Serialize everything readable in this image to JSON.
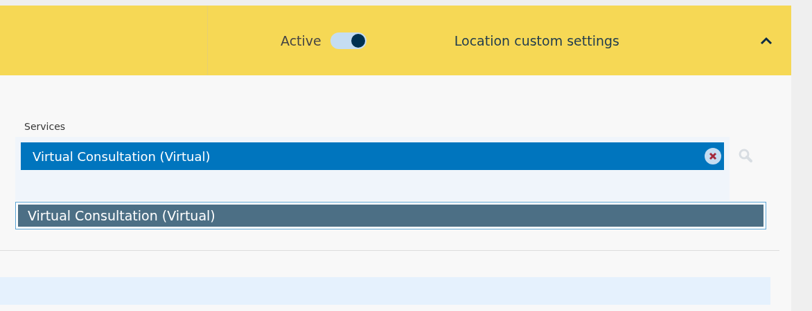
{
  "header": {
    "toggle_label": "Active",
    "active": true,
    "title": "Location custom settings",
    "expanded": true
  },
  "services": {
    "label": "Services",
    "chips": [
      {
        "label": "Virtual Consultation (Virtual)"
      }
    ],
    "options": [
      {
        "label": "Virtual Consultation (Virtual)",
        "selected": true
      }
    ]
  }
}
